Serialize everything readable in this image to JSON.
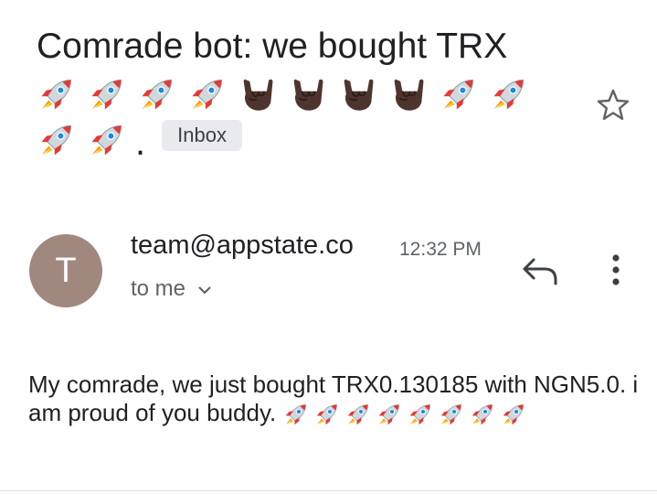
{
  "subject": {
    "text": "Comrade bot: we bought TRX",
    "emoji_line": [
      "rocket",
      "rocket",
      "rocket",
      "rocket",
      "sign-of-horns",
      "sign-of-horns",
      "sign-of-horns",
      "sign-of-horns",
      "rocket",
      "rocket"
    ],
    "emoji_line2": [
      "rocket",
      "rocket"
    ],
    "trailing": ".",
    "label_chip": "Inbox"
  },
  "sender": {
    "avatar_letter": "T",
    "avatar_color": "#a1887f",
    "email": "team@appstate.co",
    "time": "12:32 PM",
    "recipient": "to me"
  },
  "body": {
    "text": "My comrade, we just bought TRX0.130185 with NGN5.0. i am proud of you buddy.",
    "rocket_count": 8
  },
  "colors": {
    "text": "#202124",
    "secondary": "#5f6368",
    "chip_bg": "#e8eaed"
  }
}
